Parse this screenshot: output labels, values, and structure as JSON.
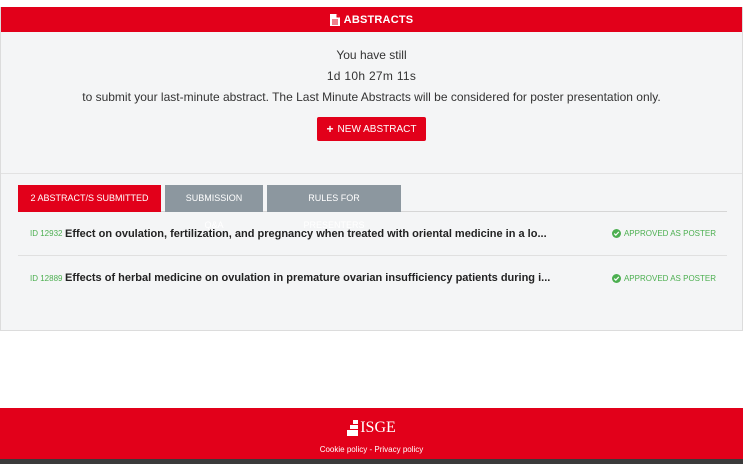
{
  "header": {
    "title": "ABSTRACTS",
    "icon": "document-icon"
  },
  "info": {
    "line1": "You have still",
    "countdown": "1d 10h 27m 11s",
    "line3": "to submit your last-minute abstract. The Last Minute Abstracts will be considered for poster presentation only.",
    "new_button": "NEW ABSTRACT"
  },
  "tabs": [
    {
      "label": "2 ABSTRACT/S SUBMITTED"
    },
    {
      "label": "SUBMISSION Q&A"
    },
    {
      "label": "RULES FOR PRESENTERS"
    }
  ],
  "abstracts": [
    {
      "id": "ID 12932",
      "title": "Effect on ovulation, fertilization, and pregnancy when treated with oriental medicine in a lo...",
      "status": "APPROVED AS POSTER"
    },
    {
      "id": "ID 12889",
      "title": "Effects of herbal medicine on ovulation in premature ovarian insufficiency patients during i...",
      "status": "APPROVED AS POSTER"
    }
  ],
  "footer": {
    "logo_text": "ISGE",
    "cookie_policy": "Cookie policy",
    "separator": " - ",
    "privacy_policy": "Privacy policy"
  },
  "colors": {
    "brand_red": "#e2001a",
    "tab_grey": "#8c979f",
    "status_green": "#4caf50"
  }
}
